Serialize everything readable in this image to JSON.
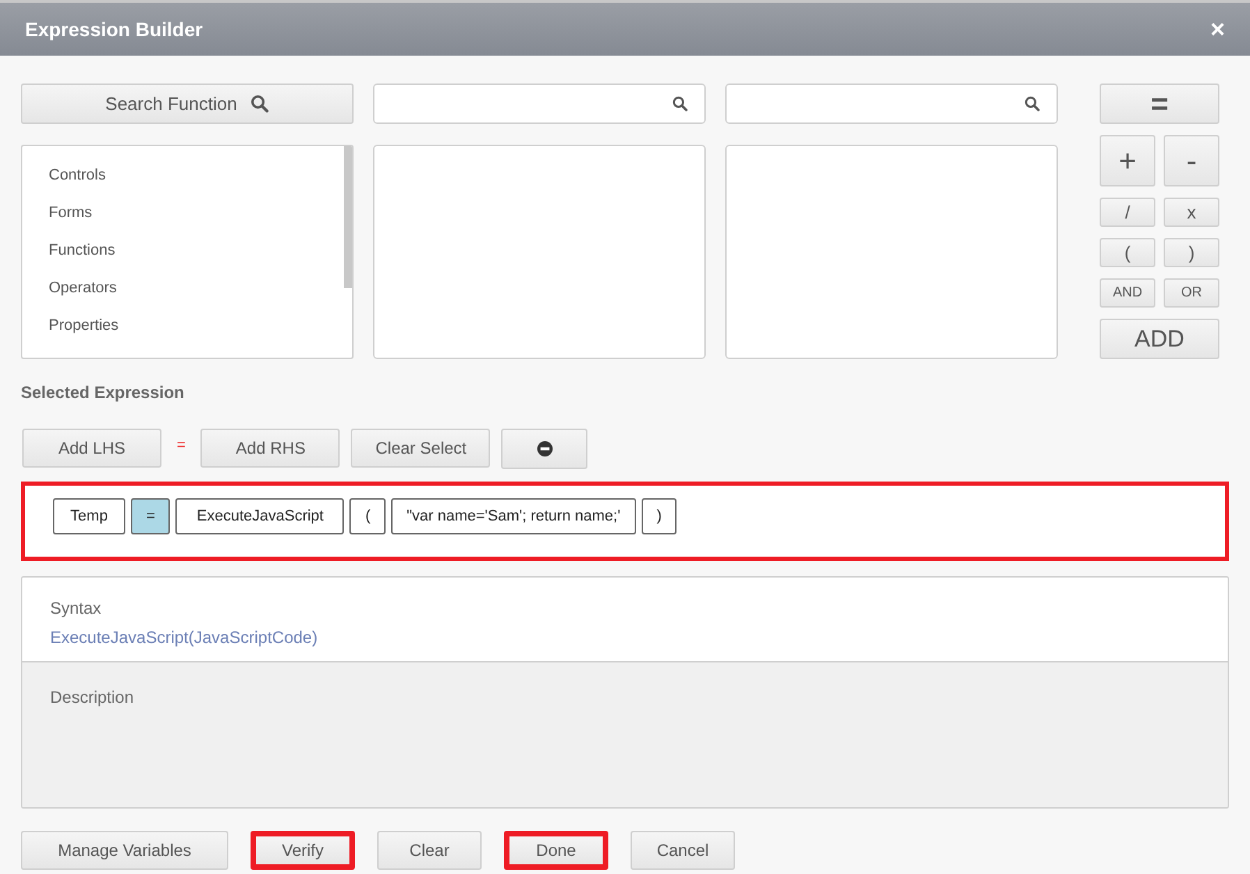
{
  "window": {
    "title": "Expression Builder",
    "close": "×"
  },
  "search_function": {
    "label": "Search Function"
  },
  "categories": [
    {
      "label": "Controls",
      "selected": false
    },
    {
      "label": "Forms",
      "selected": false
    },
    {
      "label": "Functions",
      "selected": false
    },
    {
      "label": "Operators",
      "selected": false
    },
    {
      "label": "Properties",
      "selected": false
    }
  ],
  "operators": {
    "equals": "=",
    "row_1": [
      "+",
      "-"
    ],
    "row_2": [
      "/",
      "x"
    ],
    "row_3": [
      "(",
      ")"
    ],
    "row_4": [
      "AND",
      "OR"
    ],
    "add": "ADD"
  },
  "selected_expression": {
    "heading": "Selected Expression",
    "add_lhs": "Add LHS",
    "separator": "=",
    "add_rhs": "Add RHS",
    "clear_select": "Clear Select",
    "highlighted": true,
    "tokens": [
      {
        "text": "Temp",
        "selected": false
      },
      {
        "text": "=",
        "selected": true
      },
      {
        "text": "ExecuteJavaScript",
        "selected": false
      },
      {
        "text": "(",
        "selected": false
      },
      {
        "text": "\"var name='Sam'; return name;'",
        "selected": false
      },
      {
        "text": ")",
        "selected": false
      }
    ]
  },
  "syntax": {
    "heading": "Syntax",
    "value": "ExecuteJavaScript(JavaScriptCode)"
  },
  "description": {
    "heading": "Description"
  },
  "footer_buttons": [
    {
      "label": "Manage Variables",
      "highlighted": false
    },
    {
      "label": "Verify",
      "highlighted": true
    },
    {
      "label": "Clear",
      "highlighted": false
    },
    {
      "label": "Done",
      "highlighted": true
    },
    {
      "label": "Cancel",
      "highlighted": false
    }
  ]
}
